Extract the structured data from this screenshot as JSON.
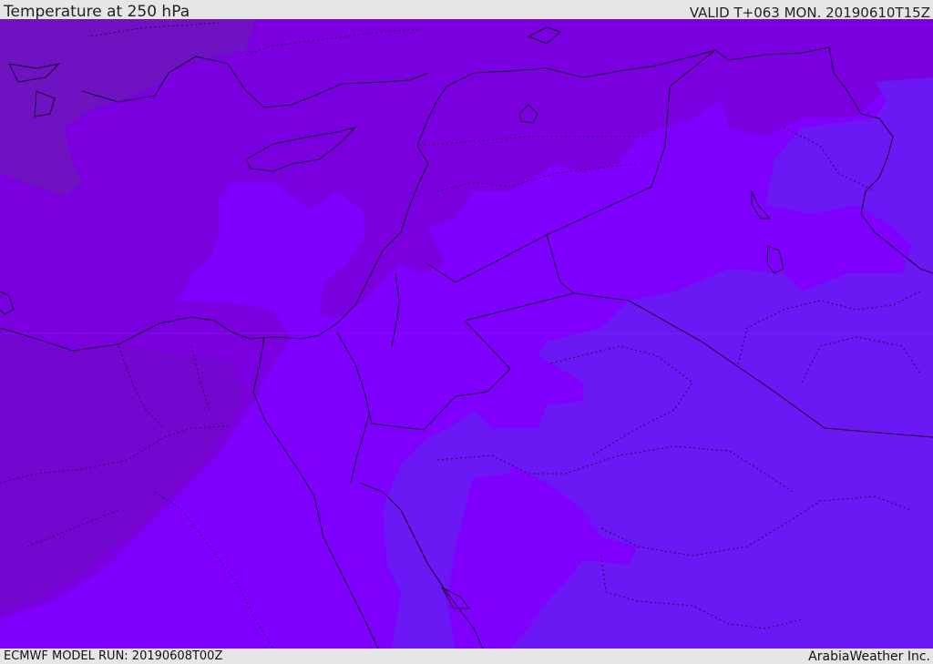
{
  "header": {
    "title": "Temperature at 250 hPa",
    "valid": "VALID T+063 MON. 20190610T15Z"
  },
  "footer": {
    "model_run": "ECMWF MODEL RUN: 20190608T00Z",
    "credit": "ArabiaWeather Inc."
  },
  "colors": {
    "coldest_band": "#6a18f4",
    "mid_band": "#7f00ff",
    "warm_band": "#7a00e0",
    "warmest_band": "#6f12c2",
    "boundary_line": "#1a0030"
  }
}
